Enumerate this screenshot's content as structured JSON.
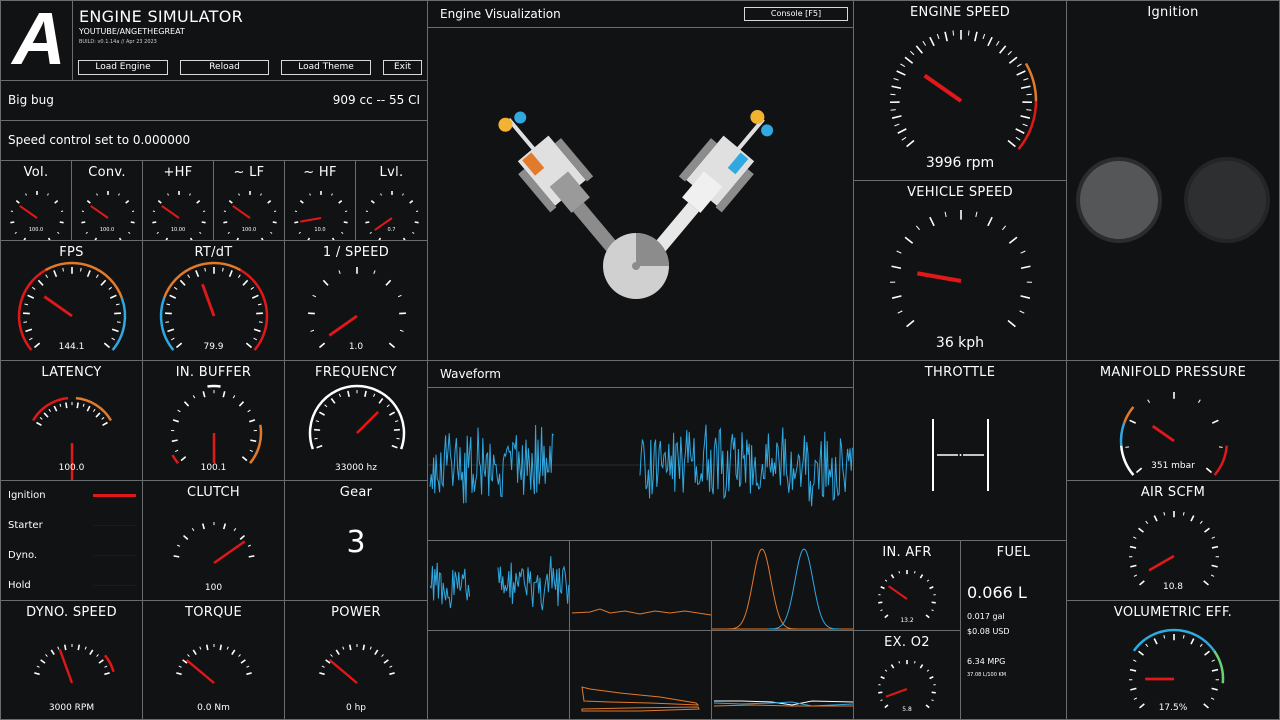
{
  "colors": {
    "background": "#111214",
    "border": "#6a6d70",
    "needle": "#e01818",
    "orange": "#e27a2b",
    "blue": "#30a8e0",
    "green": "#6ccf72",
    "white": "#ffffff"
  },
  "header": {
    "logo": "A",
    "title": "ENGINE SIMULATOR",
    "subtitle": "YOUTUBE/ANGETHEGREAT",
    "build": "BUILD: v0.1.14a // Apr 23 2023",
    "buttons": {
      "load_engine": "Load Engine",
      "reload": "Reload",
      "load_theme": "Load Theme",
      "exit": "Exit"
    }
  },
  "engine_info": {
    "name": "Big bug",
    "displacement": "909 cc -- 55 CI"
  },
  "speed_control": "Speed control set to 0.000000",
  "small_gauges": [
    {
      "title": "Vol.",
      "value": "100.0"
    },
    {
      "title": "Conv.",
      "value": "100.0"
    },
    {
      "title": "+HF",
      "value": "10.00"
    },
    {
      "title": "~ LF",
      "value": "100.0"
    },
    {
      "title": "~ HF",
      "value": "10.0"
    },
    {
      "title": "Lvl.",
      "value": "0.7"
    }
  ],
  "perf_gauges": {
    "fps": {
      "title": "FPS",
      "value": "144.1"
    },
    "rtdt": {
      "title": "RT/dT",
      "value": "79.9"
    },
    "inv_speed": {
      "title": "1 / SPEED",
      "value": "1.0"
    }
  },
  "audio_gauges": {
    "latency": {
      "title": "LATENCY",
      "value": "100.0"
    },
    "in_buffer": {
      "title": "IN. BUFFER",
      "value": "100.1"
    },
    "frequency": {
      "title": "FREQUENCY",
      "value": "33000 hz"
    }
  },
  "toggles": [
    {
      "label": "Ignition",
      "on": true
    },
    {
      "label": "Starter",
      "on": false
    },
    {
      "label": "Dyno.",
      "on": false
    },
    {
      "label": "Hold",
      "on": false
    }
  ],
  "clutch": {
    "title": "CLUTCH",
    "value": "100"
  },
  "gear": {
    "title": "Gear",
    "value": "3"
  },
  "dyno_speed": {
    "title": "DYNO. SPEED",
    "value": "3000 RPM"
  },
  "torque": {
    "title": "TORQUE",
    "value": "0.0 Nm"
  },
  "power": {
    "title": "POWER",
    "value": "0 hp"
  },
  "visualization": {
    "title": "Engine Visualization",
    "console_button": "Console [F5]"
  },
  "waveform": {
    "title": "Waveform"
  },
  "engine_speed": {
    "title": "ENGINE SPEED",
    "value": "3996 rpm"
  },
  "vehicle_speed": {
    "title": "VEHICLE SPEED",
    "value": "36 kph"
  },
  "ignition": {
    "title": "Ignition"
  },
  "throttle": {
    "title": "THROTTLE"
  },
  "manifold_pressure": {
    "title": "MANIFOLD PRESSURE",
    "value": "351 mbar"
  },
  "air_scfm": {
    "title": "AIR SCFM",
    "value": "10.8"
  },
  "volumetric_eff": {
    "title": "VOLUMETRIC EFF.",
    "value": "17.5%"
  },
  "in_afr": {
    "title": "IN. AFR",
    "value": "13.2"
  },
  "ex_o2": {
    "title": "EX. O2",
    "value": "5.8"
  },
  "fuel": {
    "title": "FUEL",
    "liters": "0.066 L",
    "gallons": "0.017 gal",
    "cost": "$0.08 USD",
    "mpg": "6.34 MPG",
    "l100": "37.08 L/100 KM"
  }
}
